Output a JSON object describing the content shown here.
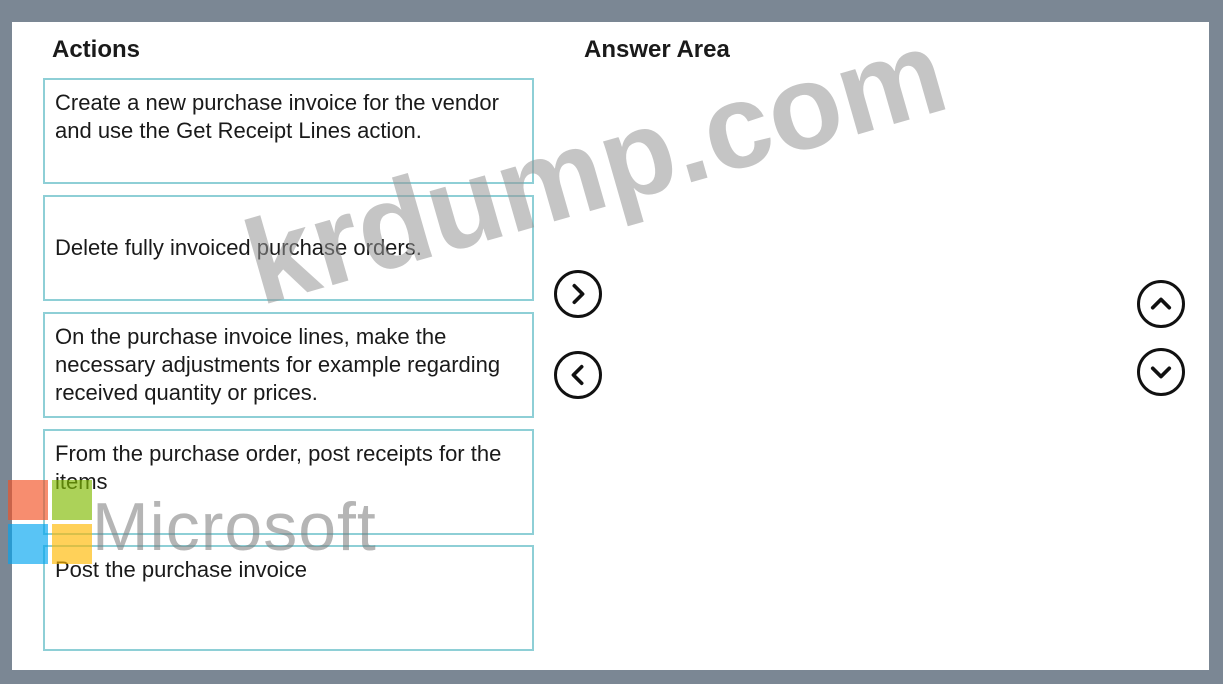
{
  "headings": {
    "actions": "Actions",
    "answer_area": "Answer Area"
  },
  "actions": [
    "Create a new purchase invoice for the vendor and use the Get Receipt Lines action.",
    "Delete fully invoiced purchase orders.",
    "On the purchase invoice lines, make the necessary adjustments for example regarding received quantity or prices.",
    "From the purchase order, post receipts for the items",
    "Post the purchase invoice"
  ],
  "controls": {
    "move_right_icon": "chevron-right-icon",
    "move_left_icon": "chevron-left-icon",
    "move_up_icon": "chevron-up-icon",
    "move_down_icon": "chevron-down-icon"
  },
  "watermark": {
    "site": "krdump.com",
    "brand": "Microsoft",
    "brand_colors": [
      "#f25022",
      "#7fba00",
      "#00a4ef",
      "#ffb900"
    ]
  }
}
